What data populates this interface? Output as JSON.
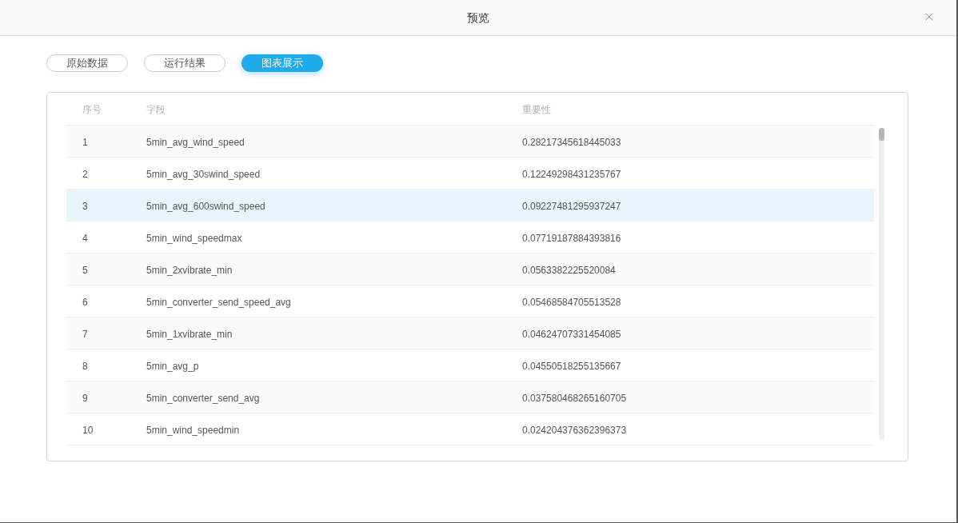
{
  "dialog": {
    "title": "预览"
  },
  "tabs": [
    {
      "label": "原始数据",
      "selected": false
    },
    {
      "label": "运行结果",
      "selected": false
    },
    {
      "label": "图表展示",
      "selected": true
    }
  ],
  "table": {
    "columns": [
      "序号",
      "字段",
      "重要性"
    ],
    "rows": [
      {
        "cells": [
          "1",
          "5min_avg_wind_speed",
          "0.28217345618445033"
        ],
        "highlighted": false
      },
      {
        "cells": [
          "2",
          "5min_avg_30swind_speed",
          "0.12249298431235767"
        ],
        "highlighted": false
      },
      {
        "cells": [
          "3",
          "5min_avg_600swind_speed",
          "0.09227481295937247"
        ],
        "highlighted": true
      },
      {
        "cells": [
          "4",
          "5min_wind_speedmax",
          "0.07719187884393816"
        ],
        "highlighted": false
      },
      {
        "cells": [
          "5",
          "5min_2xvibrate_min",
          "0.0563382225520084"
        ],
        "highlighted": false
      },
      {
        "cells": [
          "6",
          "5min_converter_send_speed_avg",
          "0.05468584705513528"
        ],
        "highlighted": false
      },
      {
        "cells": [
          "7",
          "5min_1xvibrate_min",
          "0.04624707331454085"
        ],
        "highlighted": false
      },
      {
        "cells": [
          "8",
          "5min_avg_p",
          "0.04550518255135667"
        ],
        "highlighted": false
      },
      {
        "cells": [
          "9",
          "5min_converter_send_avg",
          "0.037580468265160705"
        ],
        "highlighted": false
      },
      {
        "cells": [
          "10",
          "5min_wind_speedmin",
          "0.024204376362396373"
        ],
        "highlighted": false
      }
    ]
  }
}
